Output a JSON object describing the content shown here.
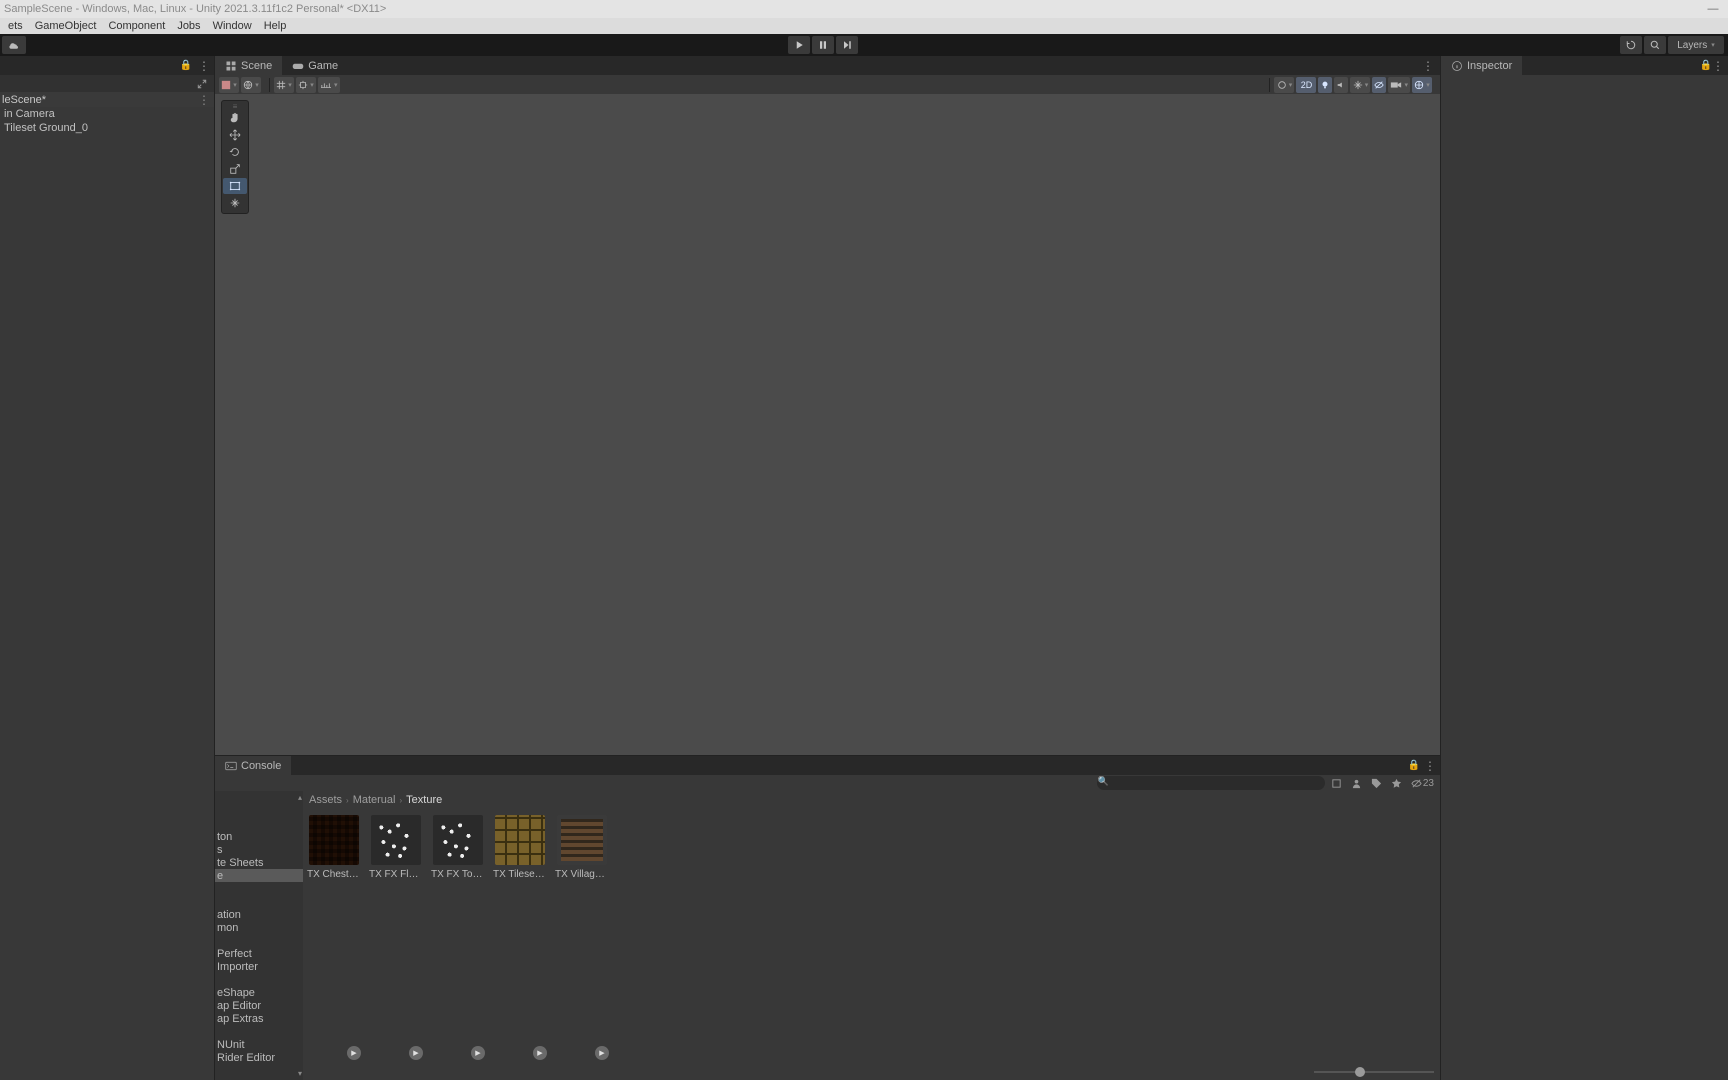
{
  "title": "SampleScene - Windows, Mac, Linux - Unity 2021.3.11f1c2 Personal* <DX11>",
  "menus": [
    "ets",
    "GameObject",
    "Component",
    "Jobs",
    "Window",
    "Help"
  ],
  "toolbar_right": {
    "layers_label": "Layers"
  },
  "hierarchy": {
    "scene_name": "leScene*",
    "objects": [
      "in Camera",
      "Tileset Ground_0"
    ]
  },
  "scene_tabs": {
    "scene": "Scene",
    "game": "Game"
  },
  "scene_toolbar": {
    "btn_2d": "2D"
  },
  "inspector_tab": "Inspector",
  "console_tab": "Console",
  "project_toolbar": {
    "hidden_count": "23"
  },
  "breadcrumb": [
    "Assets",
    "Materual",
    "Texture"
  ],
  "folders_top": [
    "",
    "ton",
    "s",
    "te Sheets",
    "e"
  ],
  "folders_bottom": [
    "ation",
    "mon",
    "",
    "Perfect",
    "Importer",
    "",
    "eShape",
    "ap Editor",
    "ap Extras",
    "",
    "NUnit",
    "Rider Editor"
  ],
  "assets": [
    {
      "label": "TX Chest …",
      "thumbClass": "chest"
    },
    {
      "label": "TX FX Fla…",
      "thumbClass": "fx"
    },
    {
      "label": "TX FX Torc…",
      "thumbClass": "fx"
    },
    {
      "label": "TX Tileset …",
      "thumbClass": "tileset"
    },
    {
      "label": "TX Village …",
      "thumbClass": "village"
    }
  ]
}
